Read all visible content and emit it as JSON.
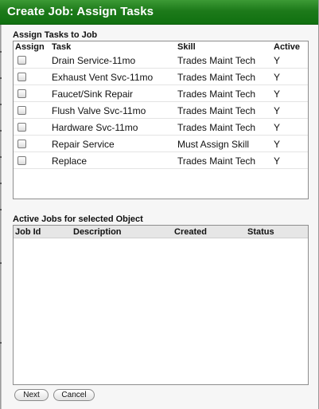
{
  "window": {
    "title": "Create Job: Assign Tasks"
  },
  "tasks_section": {
    "label": "Assign Tasks to Job",
    "columns": {
      "assign": "Assign",
      "task": "Task",
      "skill": "Skill",
      "active": "Active"
    },
    "rows": [
      {
        "task": "Drain Service-11mo",
        "skill": "Trades Maint Tech",
        "active": "Y"
      },
      {
        "task": "Exhaust Vent Svc-11mo",
        "skill": "Trades Maint Tech",
        "active": "Y"
      },
      {
        "task": "Faucet/Sink Repair",
        "skill": "Trades Maint Tech",
        "active": "Y"
      },
      {
        "task": "Flush Valve Svc-11mo",
        "skill": "Trades Maint Tech",
        "active": "Y"
      },
      {
        "task": "Hardware Svc-11mo",
        "skill": "Trades Maint Tech",
        "active": "Y"
      },
      {
        "task": "Repair Service",
        "skill": "Must Assign Skill",
        "active": "Y"
      },
      {
        "task": "Replace",
        "skill": "Trades Maint Tech",
        "active": "Y"
      }
    ]
  },
  "jobs_section": {
    "label": "Active Jobs for selected Object",
    "columns": {
      "job_id": "Job Id",
      "description": "Description",
      "created": "Created",
      "status": "Status"
    },
    "rows": []
  },
  "buttons": {
    "next": "Next",
    "cancel": "Cancel"
  },
  "colors": {
    "title_bar": "#1d7a1a",
    "title_text": "#ffffff"
  }
}
